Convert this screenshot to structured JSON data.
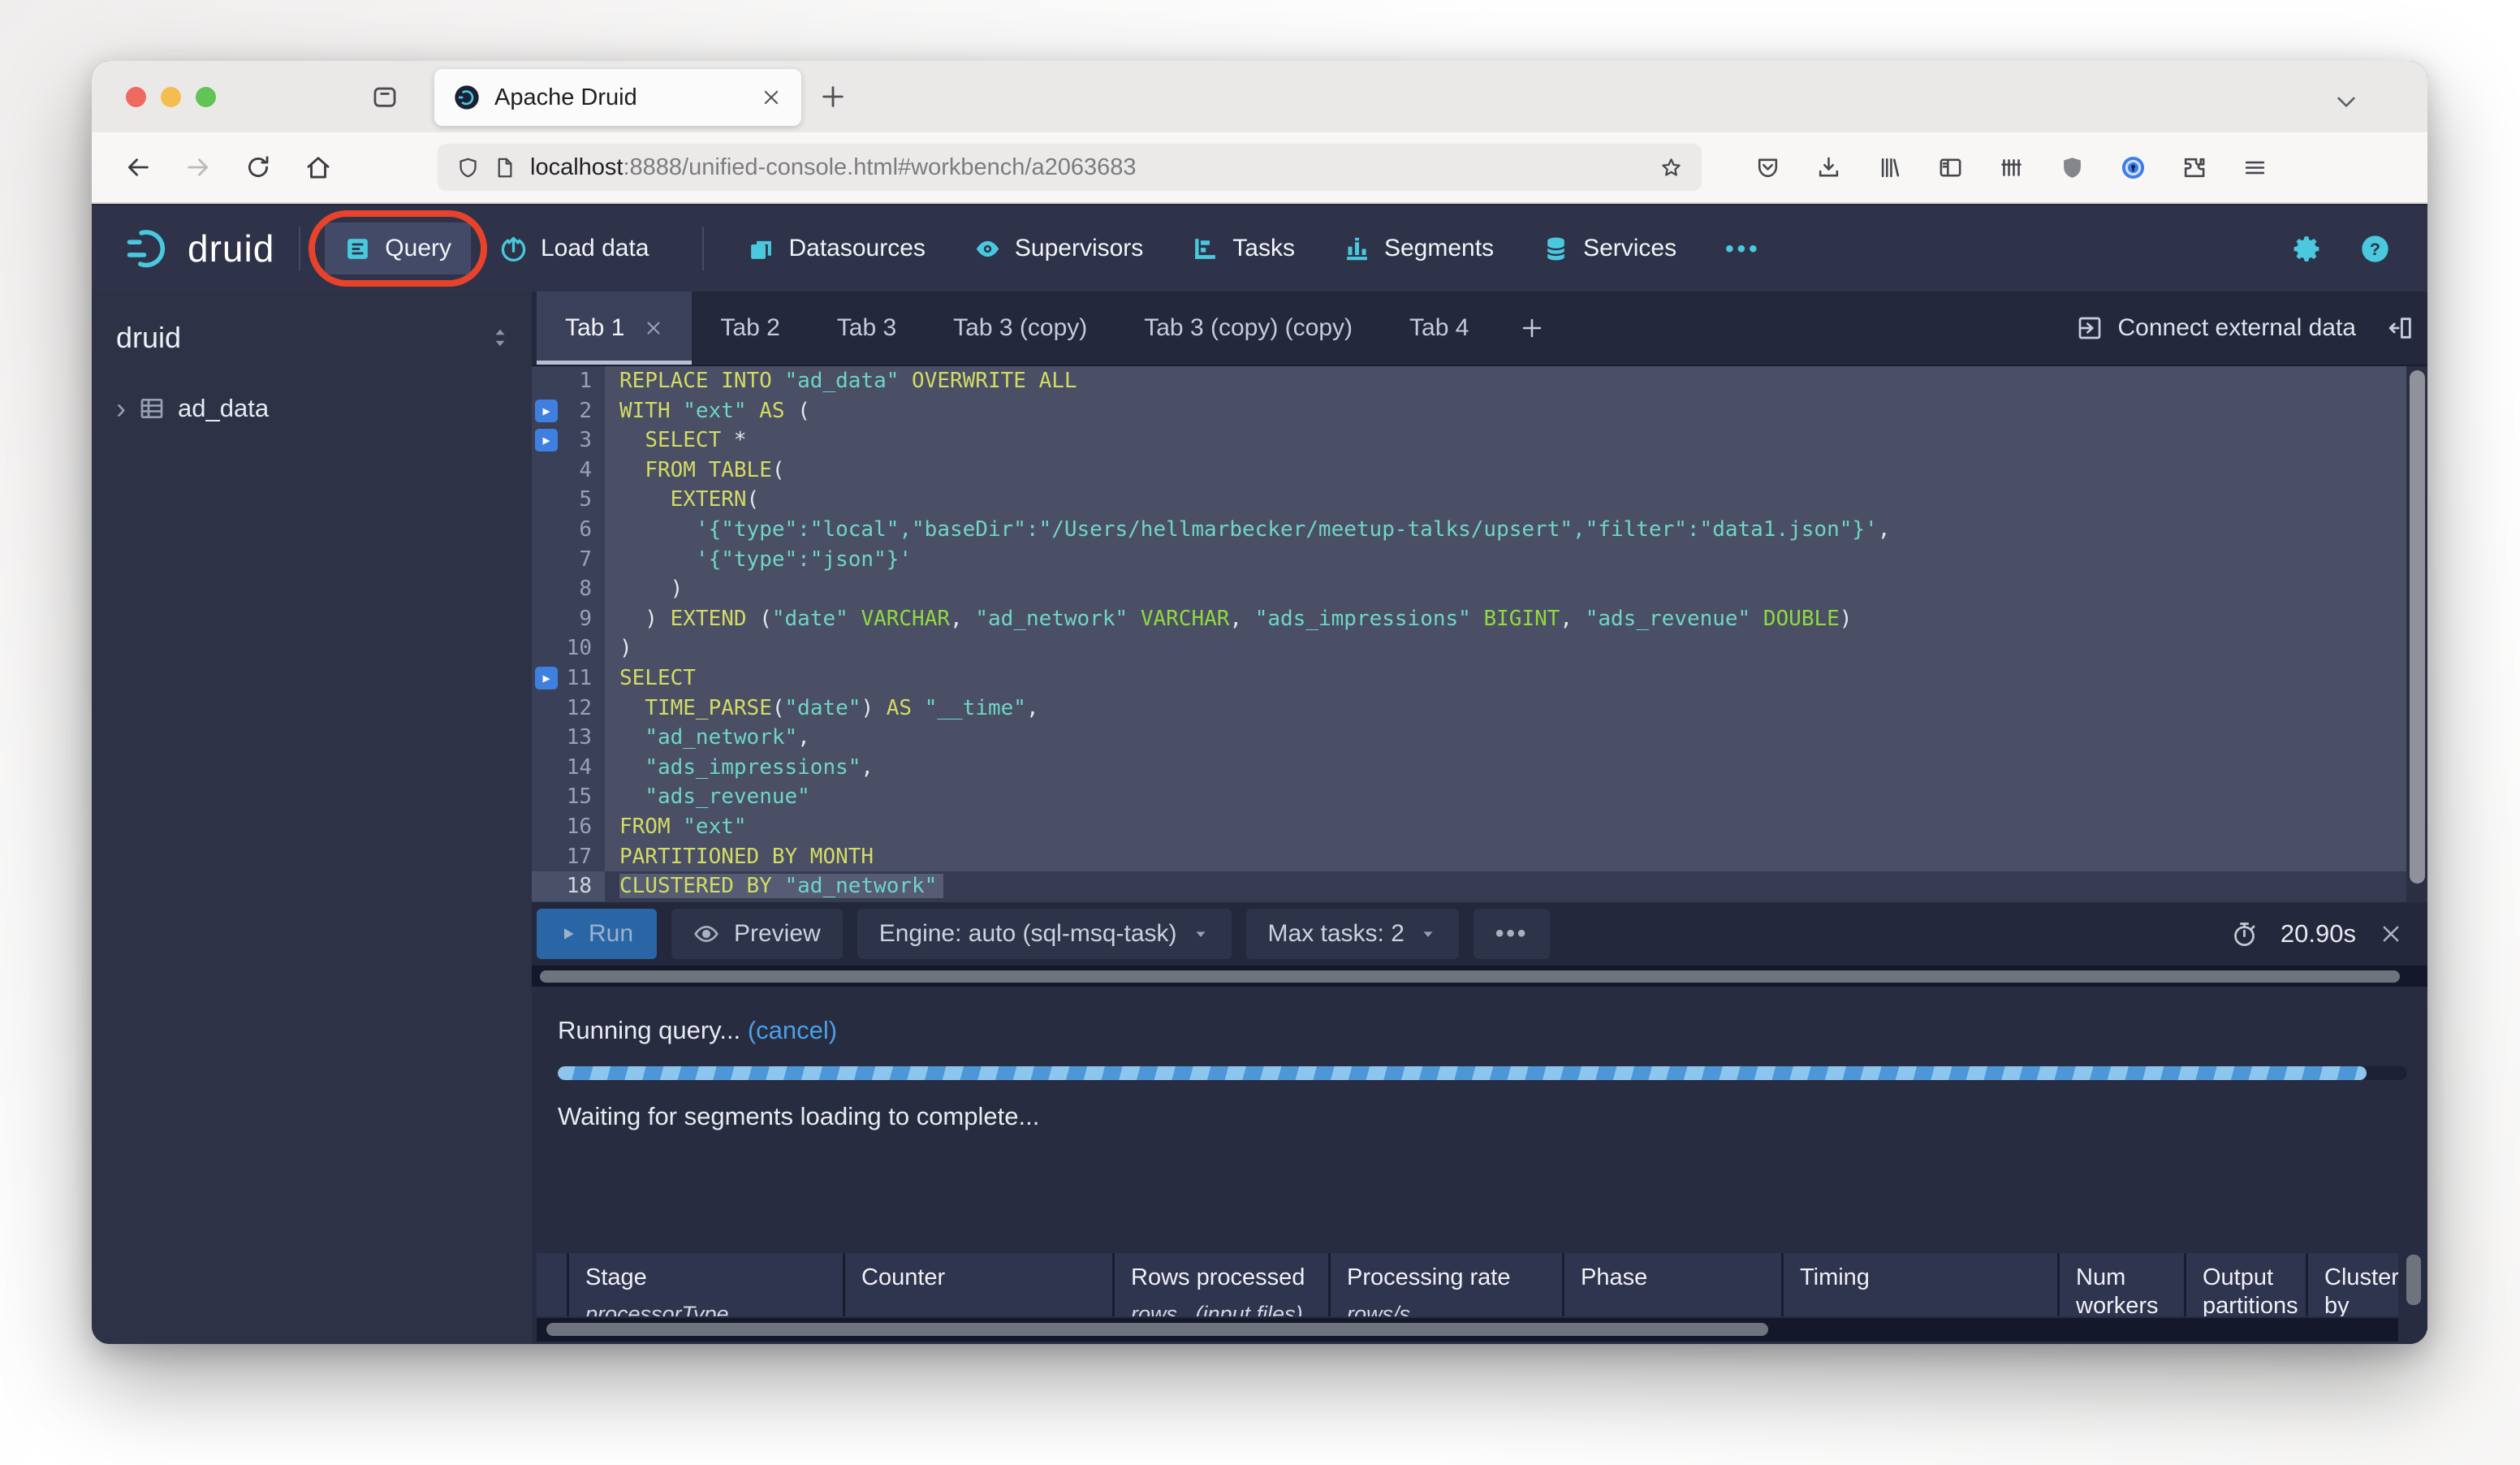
{
  "browser": {
    "window_controls": [
      "close",
      "minimize",
      "zoom"
    ],
    "tab": {
      "title": "Apache Druid"
    },
    "url": {
      "host": "localhost",
      "rest": ":8888/unified-console.html#workbench/a2063683"
    },
    "toolbar_icons": [
      "pocket",
      "download",
      "library",
      "sidebar-toggle",
      "containers",
      "ublock-origin",
      "onepassword",
      "extensions",
      "menu"
    ]
  },
  "navbar": {
    "logo_text": "druid",
    "items": [
      {
        "label": "Query",
        "icon": "query",
        "active": true,
        "annotated": true
      },
      {
        "label": "Load data",
        "icon": "load-data"
      },
      {
        "label": "Datasources",
        "icon": "datasources",
        "divider_before": true
      },
      {
        "label": "Supervisors",
        "icon": "supervisors"
      },
      {
        "label": "Tasks",
        "icon": "tasks"
      },
      {
        "label": "Segments",
        "icon": "segments"
      },
      {
        "label": "Services",
        "icon": "services"
      },
      {
        "label": "",
        "icon": "more"
      }
    ]
  },
  "sidebar": {
    "schema": "druid",
    "items": [
      {
        "label": "ad_data"
      }
    ]
  },
  "workbench": {
    "tabs": [
      {
        "label": "Tab 1",
        "active": true
      },
      {
        "label": "Tab 2"
      },
      {
        "label": "Tab 3"
      },
      {
        "label": "Tab 3 (copy)"
      },
      {
        "label": "Tab 3 (copy) (copy)"
      },
      {
        "label": "Tab 4"
      }
    ],
    "connect_external_label": "Connect external data"
  },
  "editor": {
    "lines": [
      {
        "n": 1,
        "tokens": [
          [
            "k",
            "REPLACE INTO "
          ],
          [
            "s",
            "\"ad_data\""
          ],
          [
            "k",
            " OVERWRITE ALL"
          ]
        ]
      },
      {
        "n": 2,
        "marker": true,
        "tokens": [
          [
            "k",
            "WITH "
          ],
          [
            "s",
            "\"ext\""
          ],
          [
            "k",
            " AS "
          ],
          [
            "p",
            "("
          ]
        ]
      },
      {
        "n": 3,
        "marker": true,
        "tokens": [
          [
            "p",
            "  "
          ],
          [
            "k",
            "SELECT"
          ],
          [
            "p",
            " *"
          ]
        ]
      },
      {
        "n": 4,
        "tokens": [
          [
            "p",
            "  "
          ],
          [
            "k",
            "FROM TABLE"
          ],
          [
            "p",
            "("
          ]
        ]
      },
      {
        "n": 5,
        "tokens": [
          [
            "p",
            "    "
          ],
          [
            "k",
            "EXTERN"
          ],
          [
            "p",
            "("
          ]
        ]
      },
      {
        "n": 6,
        "tokens": [
          [
            "p",
            "      "
          ],
          [
            "s",
            "'{\"type\":\"local\",\"baseDir\":\"/Users/hellmarbecker/meetup-talks/upsert\",\"filter\":\"data1.json\"}'"
          ],
          [
            "p",
            ","
          ]
        ]
      },
      {
        "n": 7,
        "tokens": [
          [
            "p",
            "      "
          ],
          [
            "s",
            "'{\"type\":\"json\"}'"
          ]
        ]
      },
      {
        "n": 8,
        "tokens": [
          [
            "p",
            "    )"
          ]
        ]
      },
      {
        "n": 9,
        "tokens": [
          [
            "p",
            "  ) "
          ],
          [
            "k",
            "EXTEND"
          ],
          [
            "p",
            " ("
          ],
          [
            "s",
            "\"date\""
          ],
          [
            "p",
            " "
          ],
          [
            "t",
            "VARCHAR"
          ],
          [
            "p",
            ", "
          ],
          [
            "s",
            "\"ad_network\""
          ],
          [
            "p",
            " "
          ],
          [
            "t",
            "VARCHAR"
          ],
          [
            "p",
            ", "
          ],
          [
            "s",
            "\"ads_impressions\""
          ],
          [
            "p",
            " "
          ],
          [
            "t",
            "BIGINT"
          ],
          [
            "p",
            ", "
          ],
          [
            "s",
            "\"ads_revenue\""
          ],
          [
            "p",
            " "
          ],
          [
            "t",
            "DOUBLE"
          ],
          [
            "p",
            ")"
          ]
        ]
      },
      {
        "n": 10,
        "tokens": [
          [
            "p",
            ")"
          ]
        ]
      },
      {
        "n": 11,
        "marker": true,
        "tokens": [
          [
            "k",
            "SELECT"
          ]
        ]
      },
      {
        "n": 12,
        "tokens": [
          [
            "p",
            "  "
          ],
          [
            "k",
            "TIME_PARSE"
          ],
          [
            "p",
            "("
          ],
          [
            "s",
            "\"date\""
          ],
          [
            "p",
            ") "
          ],
          [
            "k",
            "AS"
          ],
          [
            "p",
            " "
          ],
          [
            "s",
            "\"__time\""
          ],
          [
            "p",
            ","
          ]
        ]
      },
      {
        "n": 13,
        "tokens": [
          [
            "p",
            "  "
          ],
          [
            "s",
            "\"ad_network\""
          ],
          [
            "p",
            ","
          ]
        ]
      },
      {
        "n": 14,
        "tokens": [
          [
            "p",
            "  "
          ],
          [
            "s",
            "\"ads_impressions\""
          ],
          [
            "p",
            ","
          ]
        ]
      },
      {
        "n": 15,
        "tokens": [
          [
            "p",
            "  "
          ],
          [
            "s",
            "\"ads_revenue\""
          ]
        ]
      },
      {
        "n": 16,
        "tokens": [
          [
            "k",
            "FROM "
          ],
          [
            "s",
            "\"ext\""
          ]
        ]
      },
      {
        "n": 17,
        "tokens": [
          [
            "k",
            "PARTITIONED BY MONTH"
          ]
        ]
      },
      {
        "n": 18,
        "active": true,
        "tokens": [
          [
            "k",
            "CLUSTERED BY "
          ],
          [
            "s",
            "\"ad_network\""
          ]
        ]
      }
    ]
  },
  "runbar": {
    "run_label": "Run",
    "preview_label": "Preview",
    "engine_label": "Engine: auto (sql-msq-task)",
    "max_tasks_label": "Max tasks: 2",
    "more_label": "•••",
    "elapsed": "20.90s"
  },
  "status": {
    "running_text": "Running query...",
    "cancel_label": "(cancel)",
    "waiting_text": "Waiting for segments loading to complete...",
    "progress_percent": 97.8
  },
  "results_table": {
    "columns": [
      {
        "label": "",
        "sub": ""
      },
      {
        "label": "Stage",
        "sub": "processorType"
      },
      {
        "label": "Counter",
        "sub": ""
      },
      {
        "label": "Rows processed",
        "sub": "rows   (input files)"
      },
      {
        "label": "Processing rate",
        "sub": "rows/s"
      },
      {
        "label": "Phase",
        "sub": ""
      },
      {
        "label": "Timing",
        "sub": ""
      },
      {
        "label": "Num workers",
        "sub": ""
      },
      {
        "label": "Output partitions",
        "sub": ""
      },
      {
        "label": "Cluster by",
        "sub": ""
      }
    ]
  },
  "colors": {
    "accent_cyan": "#49c8de",
    "navbar_bg": "#2e3349",
    "run_button_blue": "#2a66a6",
    "annotation_red": "#e8432a",
    "progress_light_blue": "#8cc5ee",
    "progress_dark_blue": "#4e97d6",
    "syntax_keyword": "#d3db63",
    "syntax_string": "#6fd5c6",
    "syntax_type": "#90d93f"
  }
}
